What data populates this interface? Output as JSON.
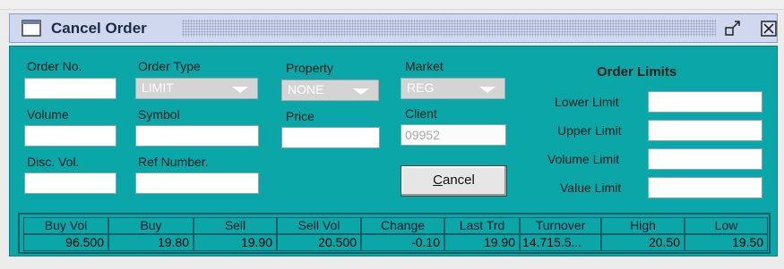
{
  "window": {
    "title": "Cancel Order"
  },
  "form": {
    "order_no": {
      "label": "Order No.",
      "value": ""
    },
    "order_type": {
      "label": "Order Type",
      "value": "LIMIT"
    },
    "property": {
      "label": "Property",
      "value": "NONE"
    },
    "market": {
      "label": "Market",
      "value": "REG"
    },
    "volume": {
      "label": "Volume",
      "value": ""
    },
    "symbol": {
      "label": "Symbol",
      "value": ""
    },
    "price": {
      "label": "Price",
      "value": ""
    },
    "client": {
      "label": "Client",
      "value": "09952"
    },
    "disc_vol": {
      "label": "Disc. Vol.",
      "value": ""
    },
    "ref_number": {
      "label": "Ref Number.",
      "value": ""
    },
    "cancel_button": {
      "label_first": "C",
      "label_rest": "ancel"
    }
  },
  "order_limits": {
    "heading": "Order Limits",
    "lower_label": "Lower Limit",
    "lower_value": "",
    "upper_label": "Upper Limit",
    "upper_value": "",
    "volume_label": "Volume Limit",
    "volume_value": "",
    "value_label": "Value Limit",
    "value_value": ""
  },
  "quote": {
    "headers": [
      "Buy Vol",
      "Buy",
      "Sell",
      "Sell Vol",
      "Change",
      "Last Trd",
      "Turnover",
      "High",
      "Low"
    ],
    "values": [
      "96.500",
      "19.80",
      "19.90",
      "20.500",
      "-0.10",
      "19.90",
      "14.715.5...",
      "20.50",
      "19.50"
    ]
  }
}
